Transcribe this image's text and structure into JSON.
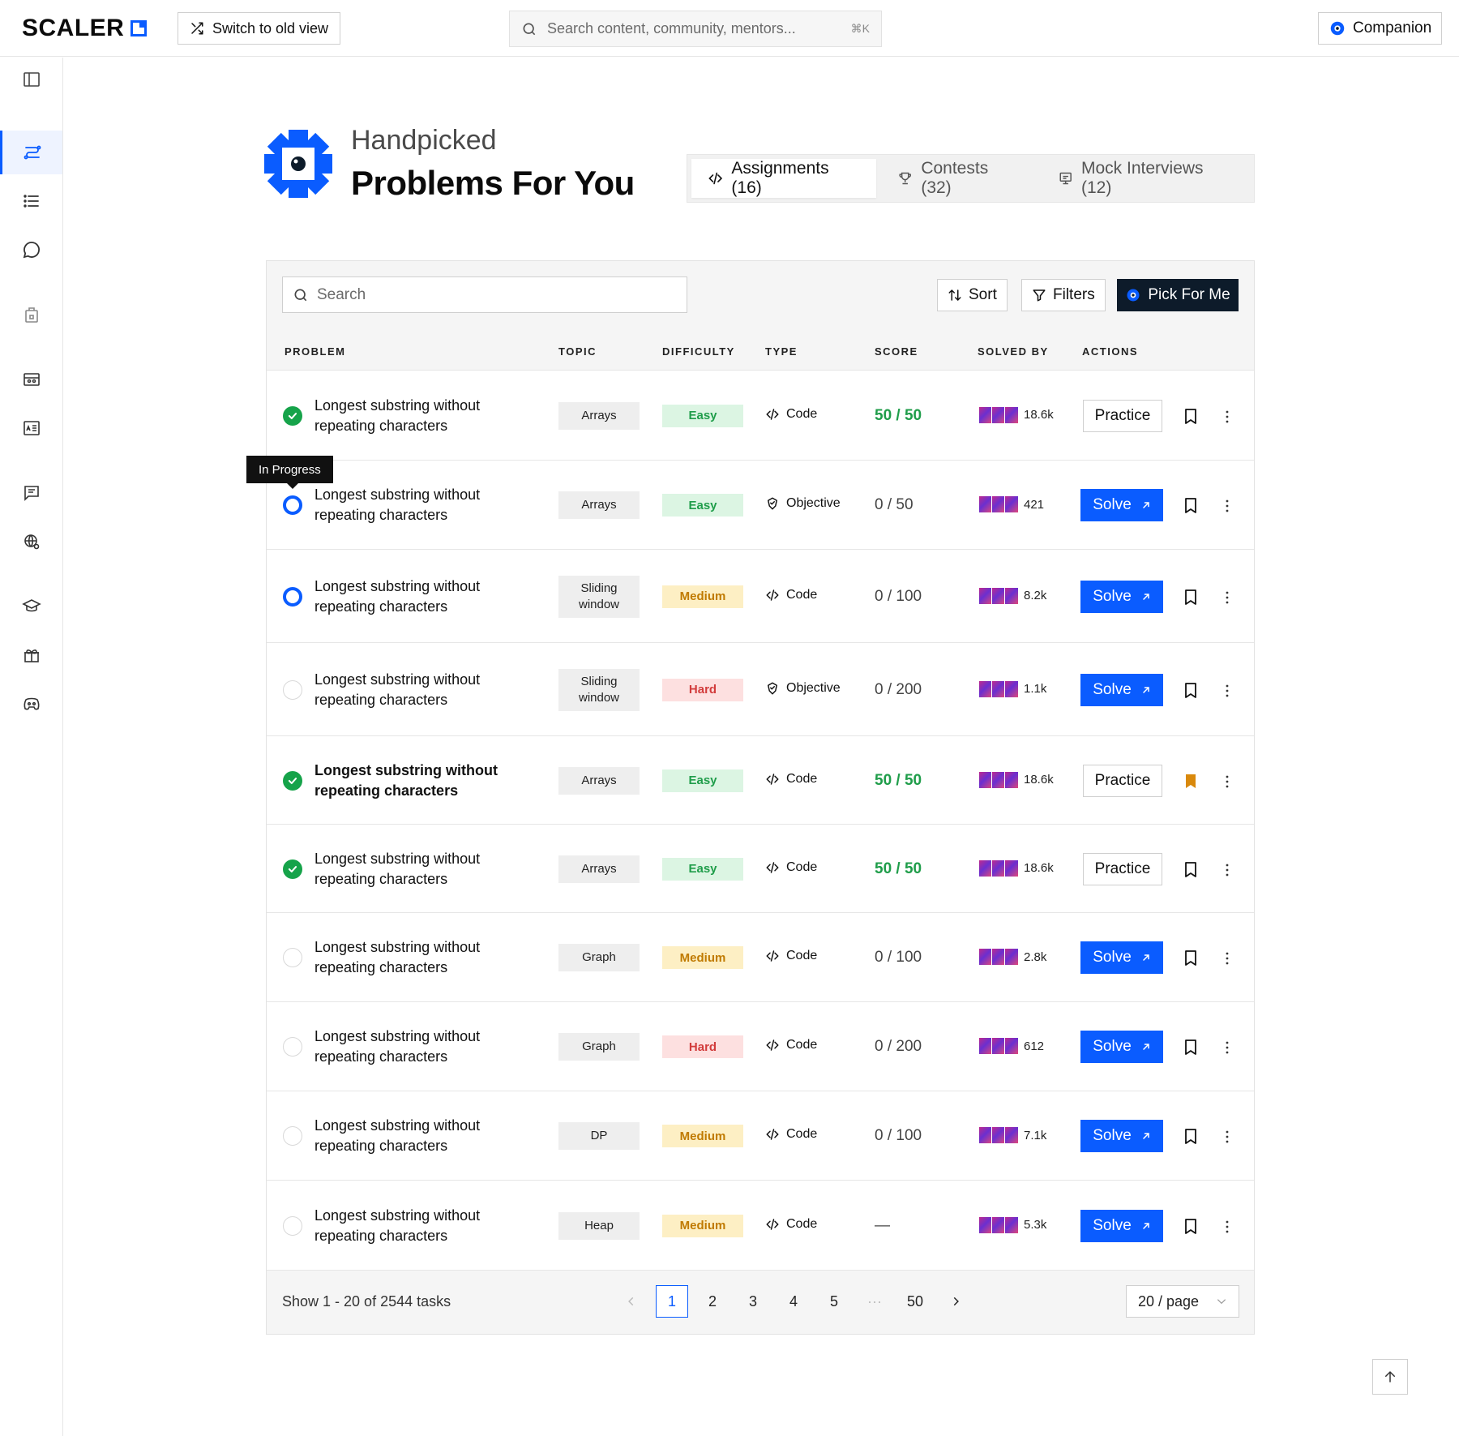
{
  "header": {
    "logo": "SCALER",
    "switch_label": "Switch to old view",
    "search_placeholder": "Search content, community, mentors...",
    "search_shortcut": "⌘K",
    "companion_label": "Companion"
  },
  "sidebar": {
    "items": [
      {
        "icon": "panel-toggle-icon"
      },
      {
        "icon": "problems-icon",
        "active": true
      },
      {
        "icon": "list-icon"
      },
      {
        "icon": "chat-icon"
      },
      {
        "icon": "jobs-icon"
      },
      {
        "icon": "events-icon"
      },
      {
        "icon": "profile-card-icon"
      },
      {
        "icon": "articles-icon"
      },
      {
        "icon": "globe-icon"
      },
      {
        "icon": "courses-icon"
      },
      {
        "icon": "rewards-icon"
      },
      {
        "icon": "discord-icon"
      }
    ]
  },
  "hero": {
    "subtitle": "Handpicked",
    "title": "Problems For You"
  },
  "tabs": [
    {
      "label": "Assignments (16)",
      "icon": "code-icon",
      "active": true
    },
    {
      "label": "Contests (32)",
      "icon": "trophy-icon",
      "active": false
    },
    {
      "label": "Mock Interviews (12)",
      "icon": "interview-icon",
      "active": false
    }
  ],
  "toolbar": {
    "search_placeholder": "Search",
    "sort_label": "Sort",
    "filters_label": "Filters",
    "pick_label": "Pick For Me"
  },
  "columns": {
    "problem": "PROBLEM",
    "topic": "TOPIC",
    "difficulty": "DIFFICULTY",
    "type": "TYPE",
    "score": "SCORE",
    "solved_by": "SOLVED BY",
    "actions": "ACTIONS"
  },
  "tooltip": "In Progress",
  "rows": [
    {
      "status": "done",
      "name_line1": "Longest substring without",
      "name_line2": "repeating characters",
      "topic_line1": "Arrays",
      "topic_line2": "",
      "difficulty": "Easy",
      "difficulty_level": "easy",
      "type": "Code",
      "type_icon": "code-icon",
      "score": "50 / 50",
      "score_full": true,
      "solved_by": "18.6k",
      "action": "Practice",
      "bookmarked": false,
      "bold": false
    },
    {
      "status": "progress",
      "name_line1": "Longest substring without",
      "name_line2": "repeating characters",
      "topic_line1": "Arrays",
      "topic_line2": "",
      "difficulty": "Easy",
      "difficulty_level": "easy",
      "type": "Objective",
      "type_icon": "objective-icon",
      "score": "0 / 50",
      "score_full": false,
      "solved_by": "421",
      "action": "Solve",
      "bookmarked": false,
      "bold": false
    },
    {
      "status": "progress",
      "name_line1": "Longest substring without",
      "name_line2": "repeating characters",
      "topic_line1": "Sliding",
      "topic_line2": "window",
      "difficulty": "Medium",
      "difficulty_level": "medium",
      "type": "Code",
      "type_icon": "code-icon",
      "score": "0 / 100",
      "score_full": false,
      "solved_by": "8.2k",
      "action": "Solve",
      "bookmarked": false,
      "bold": false
    },
    {
      "status": "todo",
      "name_line1": "Longest substring without",
      "name_line2": "repeating characters",
      "topic_line1": "Sliding",
      "topic_line2": "window",
      "difficulty": "Hard",
      "difficulty_level": "hard",
      "type": "Objective",
      "type_icon": "objective-icon",
      "score": "0 / 200",
      "score_full": false,
      "solved_by": "1.1k",
      "action": "Solve",
      "bookmarked": false,
      "bold": false
    },
    {
      "status": "done",
      "name_line1": "Longest substring without",
      "name_line2": "repeating characters",
      "topic_line1": "Arrays",
      "topic_line2": "",
      "difficulty": "Easy",
      "difficulty_level": "easy",
      "type": "Code",
      "type_icon": "code-icon",
      "score": "50 / 50",
      "score_full": true,
      "solved_by": "18.6k",
      "action": "Practice",
      "bookmarked": true,
      "bold": true
    },
    {
      "status": "done",
      "name_line1": "Longest substring without",
      "name_line2": "repeating characters",
      "topic_line1": "Arrays",
      "topic_line2": "",
      "difficulty": "Easy",
      "difficulty_level": "easy",
      "type": "Code",
      "type_icon": "code-icon",
      "score": "50 / 50",
      "score_full": true,
      "solved_by": "18.6k",
      "action": "Practice",
      "bookmarked": false,
      "bold": false
    },
    {
      "status": "todo",
      "name_line1": "Longest substring without",
      "name_line2": "repeating characters",
      "topic_line1": "Graph",
      "topic_line2": "",
      "difficulty": "Medium",
      "difficulty_level": "medium",
      "type": "Code",
      "type_icon": "code-icon",
      "score": "0 / 100",
      "score_full": false,
      "solved_by": "2.8k",
      "action": "Solve",
      "bookmarked": false,
      "bold": false
    },
    {
      "status": "todo",
      "name_line1": "Longest substring without",
      "name_line2": "repeating characters",
      "topic_line1": "Graph",
      "topic_line2": "",
      "difficulty": "Hard",
      "difficulty_level": "hard",
      "type": "Code",
      "type_icon": "code-icon",
      "score": "0 / 200",
      "score_full": false,
      "solved_by": "612",
      "action": "Solve",
      "bookmarked": false,
      "bold": false
    },
    {
      "status": "todo",
      "name_line1": "Longest substring without",
      "name_line2": "repeating characters",
      "topic_line1": "DP",
      "topic_line2": "",
      "difficulty": "Medium",
      "difficulty_level": "medium",
      "type": "Code",
      "type_icon": "code-icon",
      "score": "0 / 100",
      "score_full": false,
      "solved_by": "7.1k",
      "action": "Solve",
      "bookmarked": false,
      "bold": false
    },
    {
      "status": "todo",
      "name_line1": "Longest substring without",
      "name_line2": "repeating characters",
      "topic_line1": "Heap",
      "topic_line2": "",
      "difficulty": "Medium",
      "difficulty_level": "medium",
      "type": "Code",
      "type_icon": "code-icon",
      "score": "—",
      "score_full": false,
      "solved_by": "5.3k",
      "action": "Solve",
      "bookmarked": false,
      "bold": false
    }
  ],
  "footer": {
    "count_text": "Show 1 - 20 of 2544 tasks",
    "pages": [
      "1",
      "2",
      "3",
      "4",
      "5",
      "···",
      "50"
    ],
    "current_page": "1",
    "per_page": "20 / page"
  },
  "colors": {
    "accent": "#0a5cff",
    "success": "#16a34a",
    "bookmark_active": "#d9890c",
    "dark_button": "#0d1b2a"
  }
}
